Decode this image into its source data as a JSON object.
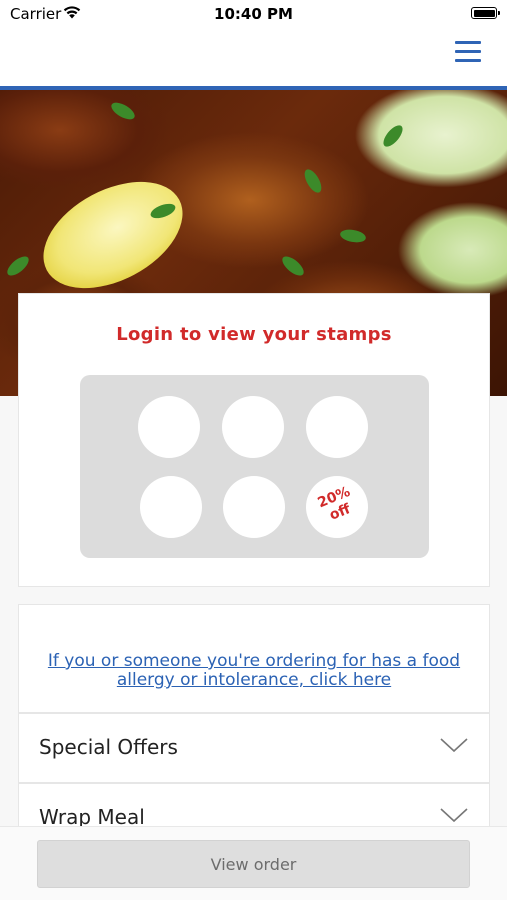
{
  "status_bar": {
    "carrier": "Carrier",
    "time": "10:40 PM",
    "icons": [
      "wifi-icon",
      "battery-icon"
    ]
  },
  "header": {
    "menu_icon": "hamburger-menu-icon",
    "accent_color": "#2f64b5"
  },
  "hero": {
    "image": "food-photo"
  },
  "stamp_card": {
    "title": "Login to view your stamps",
    "title_color": "#d12a2a",
    "stamps_total": 6,
    "stamps_collected": 0,
    "reward_label": "20% off"
  },
  "allergy": {
    "link_text": "If you or someone you're ordering for has a food allergy or intolerance, click here"
  },
  "categories": [
    {
      "label": "Special Offers"
    },
    {
      "label": "Wrap Meal"
    }
  ],
  "footer": {
    "view_order_label": "View order"
  }
}
